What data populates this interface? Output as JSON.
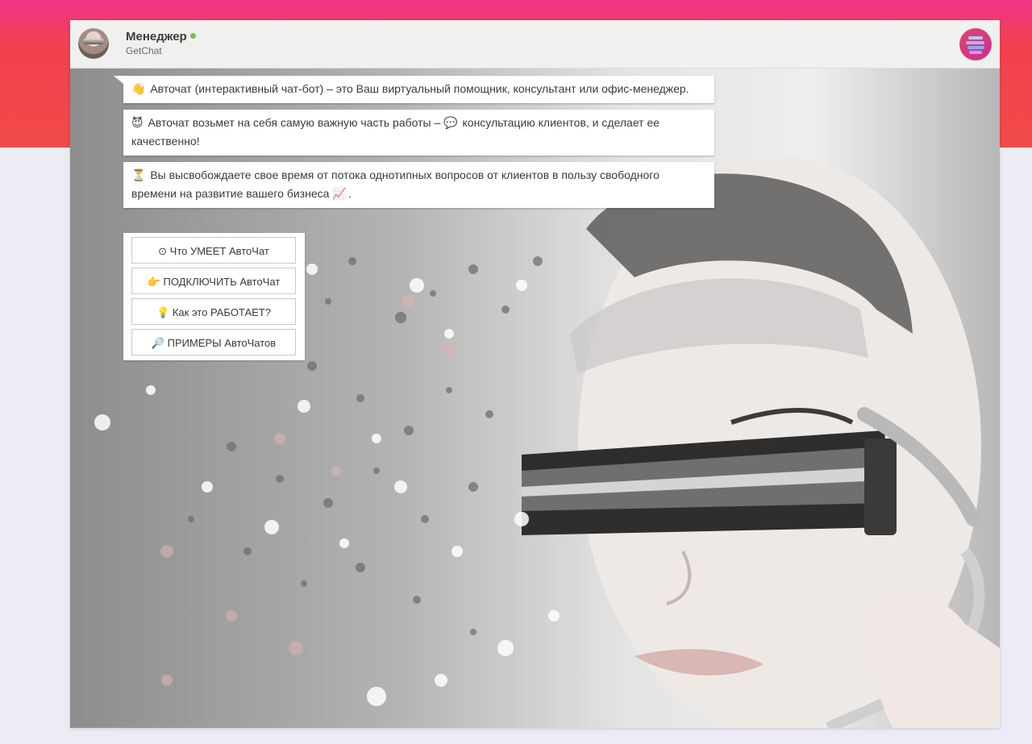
{
  "header": {
    "agent_name": "Менеджер",
    "company": "GetChat",
    "online_color": "#7ac043",
    "logo_icon": "getchat-logo-icon"
  },
  "messages": [
    {
      "icon": "👋",
      "icon_name": "waving-hand-icon",
      "text": "Авточат (интерактивный чат-бот) – это Ваш виртуальный помощник, консультант или офис-менеджер."
    },
    {
      "icon": "😈",
      "icon_name": "smiling-devil-icon",
      "text_before": "Авточат возьмет на себя самую важную часть работы – ",
      "inline_icon": "💬",
      "inline_icon_name": "speech-bubble-icon",
      "text_after": " консультацию клиентов, и сделает ее качественно!"
    },
    {
      "icon": "⏳",
      "icon_name": "hourglass-icon",
      "text": "Вы высвобождаете свое время от потока однотипных вопросов от клиентов в пользу свободного времени на развитие вашего бизнеса ",
      "trail_icon": "📈",
      "trail_icon_name": "chart-increasing-icon",
      "trail_text": "."
    }
  ],
  "buttons": [
    {
      "icon": "⊙",
      "icon_name": "question-circle-icon",
      "label": "Что УМЕЕТ АвтоЧат"
    },
    {
      "icon": "👉",
      "icon_name": "pointing-hand-icon",
      "label": "ПОДКЛЮЧИТЬ АвтоЧат"
    },
    {
      "icon": "💡",
      "icon_name": "light-bulb-icon",
      "label": "Как это РАБОТАЕТ?"
    },
    {
      "icon": "🔎",
      "icon_name": "magnifying-glass-icon",
      "label": "ПРИМЕРЫ АвтоЧатов"
    }
  ],
  "colors": {
    "top_band": "#f2414f",
    "page_background": "#ecebf6",
    "header_background": "#f0f0ee"
  }
}
